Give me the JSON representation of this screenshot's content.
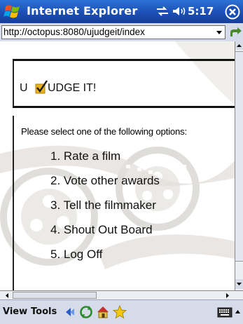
{
  "titlebar": {
    "app_title": "Internet Explorer",
    "time": "5:17",
    "icons": [
      "windows-start-icon",
      "connectivity-icon",
      "speaker-icon",
      "close-icon"
    ]
  },
  "address": {
    "url": "http://octopus:8080/ujudgeit/index"
  },
  "page": {
    "brand_pre": "U",
    "brand_post": "UDGE IT!",
    "instruction": "Please select one of the following options:",
    "options": [
      "1. Rate a film",
      "2. Vote other awards",
      "3. Tell the filmmaker",
      "4. Shout Out Board",
      "5. Log Off"
    ]
  },
  "menubar": {
    "view_label": "View",
    "tools_label": "Tools",
    "icons": [
      "back-icon",
      "refresh-icon",
      "home-icon",
      "favorites-icon",
      "keyboard-icon"
    ]
  },
  "colors": {
    "titlebar": "#1c4fb4",
    "menubar": "#d6dbe9",
    "check_box": "#e8b21a",
    "check_mark": "#1a1a1a"
  }
}
